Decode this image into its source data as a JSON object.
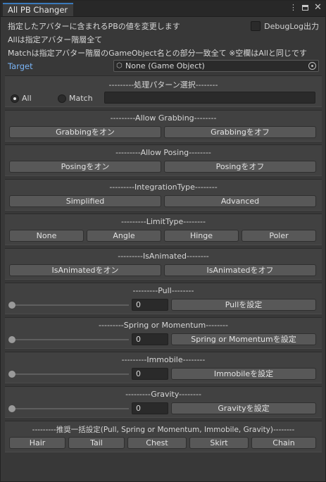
{
  "window": {
    "tab_title": "All PB Changer"
  },
  "header": {
    "desc1": "指定したアバターに含まれるPBの値を変更します",
    "debug_label": "DebugLog出力",
    "desc2": "Allは指定アバター階層全て",
    "desc3": "Matchは指定アバター階層のGameObject名との部分一致全て ※空欄はAllと同じです",
    "target_label": "Target",
    "target_value": "None (Game Object)"
  },
  "mode": {
    "title": "---------処理パターン選択--------",
    "all_label": "All",
    "match_label": "Match",
    "match_value": ""
  },
  "grabbing": {
    "title": "---------Allow Grabbing--------",
    "on": "Grabbingをオン",
    "off": "Grabbingをオフ"
  },
  "posing": {
    "title": "---------Allow Posing--------",
    "on": "Posingをオン",
    "off": "Posingをオフ"
  },
  "integration": {
    "title": "---------IntegrationType--------",
    "simplified": "Simplified",
    "advanced": "Advanced"
  },
  "limit": {
    "title": "---------LimitType--------",
    "none": "None",
    "angle": "Angle",
    "hinge": "Hinge",
    "poler": "Poler"
  },
  "animated": {
    "title": "---------IsAnimated--------",
    "on": "IsAnimatedをオン",
    "off": "IsAnimatedをオフ"
  },
  "pull": {
    "title": "---------Pull--------",
    "value": "0",
    "slider": 0,
    "button": "Pullを設定"
  },
  "spring": {
    "title": "---------Spring or Momentum--------",
    "value": "0",
    "slider": 0,
    "button": "Spring or Momentumを設定"
  },
  "immobile": {
    "title": "---------Immobile--------",
    "value": "0",
    "slider": 0,
    "button": "Immobileを設定"
  },
  "gravity": {
    "title": "---------Gravity--------",
    "value": "0",
    "slider": 0,
    "button": "Gravityを設定"
  },
  "presets": {
    "title": "---------推奨一括設定(Pull, Spring or Momentum, Immobile, Gravity)--------",
    "hair": "Hair",
    "tail": "Tail",
    "chest": "Chest",
    "skirt": "Skirt",
    "chain": "Chain"
  }
}
